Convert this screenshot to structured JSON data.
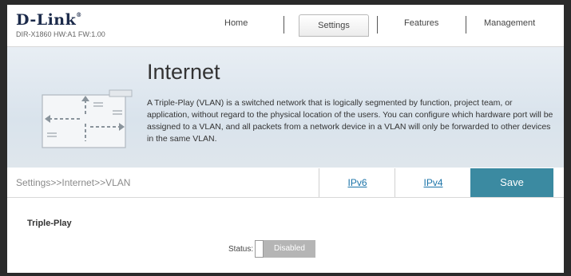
{
  "header": {
    "logo_text": "D-Link",
    "hw_info": "DIR-X1860 HW:A1 FW:1.00",
    "nav": {
      "home": "Home",
      "settings": "Settings",
      "features": "Features",
      "management": "Management"
    }
  },
  "banner": {
    "title": "Internet",
    "description": "A Triple-Play (VLAN) is a switched network that is logically segmented by function, project team, or application, without regard to the physical location of the users. You can configure which hardware port will be assigned to a VLAN, and all packets from a network device in a VLAN will only be forwarded to other devices in the same VLAN."
  },
  "subnav": {
    "breadcrumb": "Settings>>Internet>>VLAN",
    "tabs": [
      "IPv6",
      "IPv4"
    ],
    "save_label": "Save"
  },
  "content": {
    "section_title": "Triple-Play",
    "status_label": "Status:",
    "status_value": "Disabled"
  },
  "colors": {
    "accent": "#3b8aa1",
    "link": "#1a73a8",
    "toggle_off": "#b5b5b5"
  }
}
